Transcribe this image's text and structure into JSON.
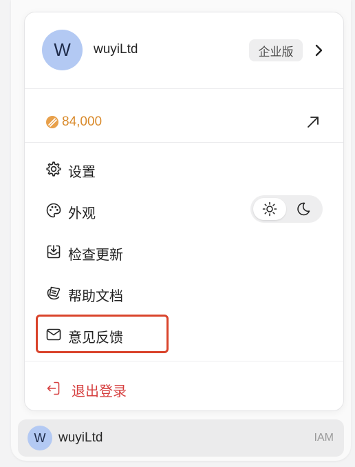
{
  "user": {
    "avatar_letter": "W",
    "name": "wuyiLtd",
    "plan": "企业版"
  },
  "credits": {
    "value": "84,000",
    "icon": "coin-icon",
    "color": "#d98a2b"
  },
  "menu": {
    "items": [
      {
        "label": "设置",
        "icon": "gear-icon"
      },
      {
        "label": "外观",
        "icon": "palette-icon"
      },
      {
        "label": "检查更新",
        "icon": "download-box-icon"
      },
      {
        "label": "帮助文档",
        "icon": "book-icon"
      },
      {
        "label": "意见反馈",
        "icon": "mail-icon"
      }
    ],
    "appearance": {
      "options": [
        "light",
        "dark"
      ],
      "selected": "light"
    },
    "logout": {
      "label": "退出登录",
      "icon": "logout-icon",
      "color": "#d64040"
    }
  },
  "footer": {
    "avatar_letter": "W",
    "name": "wuyiLtd",
    "tag": "IAM"
  },
  "colors": {
    "avatar_bg": "#b3c9f3",
    "highlight": "#d9432b"
  }
}
